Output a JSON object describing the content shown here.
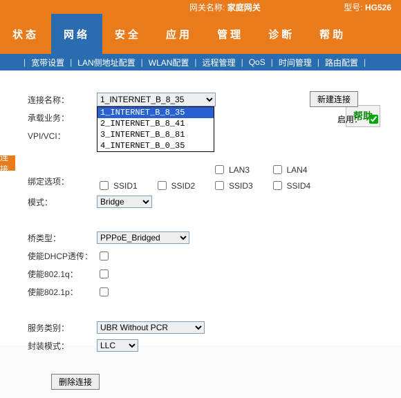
{
  "header": {
    "gateway_label": "网关名称:",
    "gateway_value": "家庭网关",
    "model_label": "型号:",
    "model_value": "HG526"
  },
  "tabs": [
    "状态",
    "网络",
    "安全",
    "应用",
    "管理",
    "诊断",
    "帮助"
  ],
  "active_tab": 1,
  "subtabs": [
    "宽带设置",
    "LAN侧地址配置",
    "WLAN配置",
    "远程管理",
    "QoS",
    "时间管理",
    "路由配置"
  ],
  "left_tag": "连接",
  "help_btn": "帮助",
  "labels": {
    "conn_name": "连接名称：",
    "service": "承载业务：",
    "vpivci": "VPI/VCI：",
    "bind_opt": "绑定选项：",
    "mode": "模式：",
    "bridge_type": "桥类型：",
    "dhcp": "使能DHCP透传：",
    "dot1q": "使能802.1q：",
    "dot1p": "使能802.1p：",
    "svc_type": "服务类别：",
    "encap": "封装模式：",
    "new_conn": "新建连接",
    "enable": "启用：",
    "del_conn": "删除连接"
  },
  "conn_selected": "1_INTERNET_B_8_35",
  "conn_options": [
    "1_INTERNET_B_8_35",
    "2_INTERNET_B_8_41",
    "3_INTERNET_B_8_81",
    "4_INTERNET_B_0_35"
  ],
  "bind_options": [
    "SSID1",
    "SSID2",
    "SSID3",
    "SSID4"
  ],
  "lan_options": [
    "LAN3",
    "LAN4"
  ],
  "mode_value": "Bridge",
  "bridge_value": "PPPoE_Bridged",
  "svc_value": "UBR Without PCR",
  "encap_value": "LLC"
}
